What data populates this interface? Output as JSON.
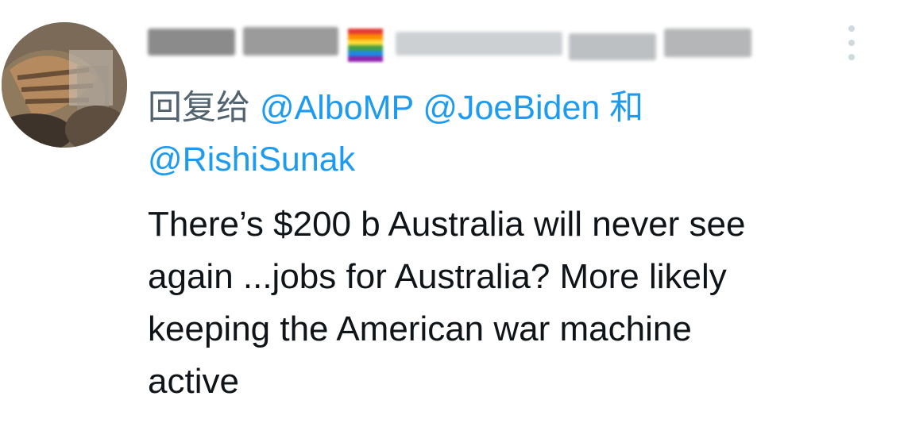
{
  "reply": {
    "prefix": "回复给",
    "mention1": "@AlboMP",
    "mention2": "@JoeBiden",
    "connector": "和",
    "mention3": "@RishiSunak"
  },
  "tweet": {
    "text": "There’s $200 b Australia will never see\nagain ...jobs for Australia? More likely\nkeeping the American war machine\nactive"
  },
  "icons": {
    "more": "more-vertical-icon",
    "avatar": "avatar-photo",
    "flag": "rainbow-flag-icon"
  },
  "colors": {
    "mention": "#1d9bf0",
    "secondary_text": "#536471",
    "primary_text": "#0f1419",
    "more_dots": "#cfd9de"
  }
}
